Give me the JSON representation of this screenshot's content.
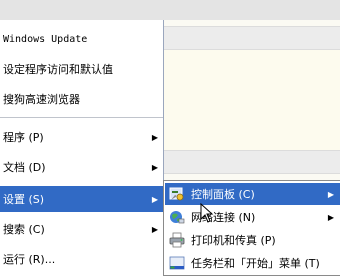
{
  "start_menu": {
    "items": [
      {
        "label": "Windows Update",
        "has_arrow": false
      },
      {
        "label": "设定程序访问和默认值",
        "has_arrow": false
      },
      {
        "label": "搜狗高速浏览器",
        "has_arrow": false
      },
      {
        "label": "程序 (P)",
        "has_arrow": true
      },
      {
        "label": "文档 (D)",
        "has_arrow": true
      },
      {
        "label": "设置 (S)",
        "has_arrow": true
      },
      {
        "label": "搜索 (C)",
        "has_arrow": true
      },
      {
        "label": "运行 (R)...",
        "has_arrow": false
      }
    ]
  },
  "settings_submenu": {
    "items": [
      {
        "label": "控制面板 (C)",
        "icon": "control-panel-icon",
        "has_arrow": true
      },
      {
        "label": "网络连接 (N)",
        "icon": "network-connections-icon",
        "has_arrow": true
      },
      {
        "label": "打印机和传真 (P)",
        "icon": "printer-icon",
        "has_arrow": false
      },
      {
        "label": "任务栏和「开始」菜单 (T)",
        "icon": "taskbar-icon",
        "has_arrow": false
      }
    ]
  },
  "colors": {
    "highlight": "#316ac5",
    "menu_bg": "#ffffff",
    "window_bg": "#fbfaf3"
  }
}
